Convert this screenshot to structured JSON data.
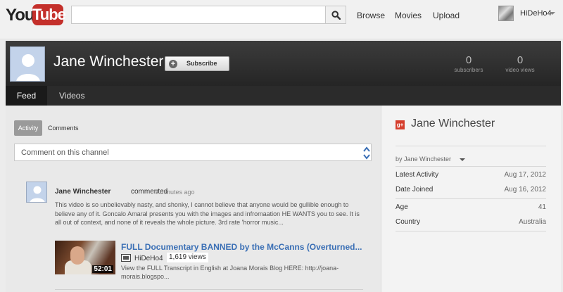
{
  "masthead": {
    "logo_you": "You",
    "logo_tube": "Tube",
    "search_placeholder": "",
    "nav": [
      "Browse",
      "Movies",
      "Upload"
    ],
    "user_name": "HiDeHo4"
  },
  "channel": {
    "title": "Jane Winchester",
    "subscribe_label": "Subscribe",
    "stats": [
      {
        "value": "0",
        "label": "subscribers"
      },
      {
        "value": "0",
        "label": "video views"
      }
    ],
    "tabs": [
      "Feed",
      "Videos"
    ]
  },
  "feed": {
    "filters": [
      "Activity",
      "Comments"
    ],
    "comment_placeholder": "Comment on this channel",
    "post": {
      "author": "Jane Winchester",
      "action": "commented",
      "time": "7 minutes ago",
      "body": "This video is so unbelievably nasty, and shonky, I cannot believe that anyone would be gullible enough to believe any of it. Goncalo Amaral presents you with the images and infromaation HE WANTS you to see. It is all out of context, and none of it reveals the whole picture. 3rd rate 'horror music...",
      "video": {
        "title": "FULL Documentary BANNED by the McCanns (Overturned...",
        "duration": "52:01",
        "uploader": "HiDeHo4",
        "views": "1,619 views",
        "description": "View the FULL Transcript in English at Joana Morais Blog HERE: http://joana-morais.blogspo..."
      }
    }
  },
  "sidebar": {
    "title": "Jane Winchester",
    "gplus_icon_text": "g+",
    "by_label": "by Jane Winchester",
    "rows": [
      {
        "label": "Latest Activity",
        "value": "Aug 17, 2012"
      },
      {
        "label": "Date Joined",
        "value": "Aug 16, 2012"
      },
      {
        "label": "Age",
        "value": "41"
      },
      {
        "label": "Country",
        "value": "Australia"
      }
    ]
  },
  "colors": {
    "brand_red": "#c4302b",
    "link_blue": "#3a6fb5",
    "header_dark": "#2b2b2b"
  }
}
